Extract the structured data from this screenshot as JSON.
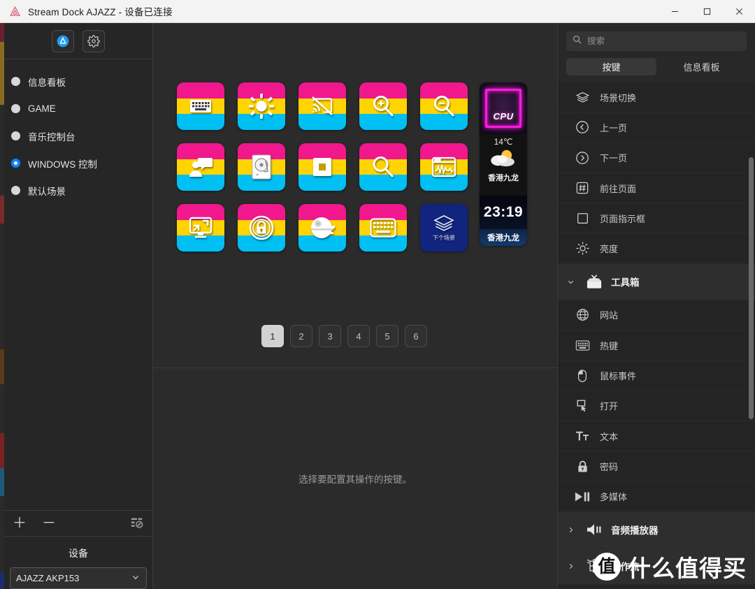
{
  "window": {
    "title": "Stream Dock AJAZZ - 设备已连接",
    "logo_icon": "ajazz-logo-icon",
    "controls": {
      "minimize": "—",
      "maximize": "☐",
      "close": "✕"
    }
  },
  "sidebar": {
    "toolbar": [
      {
        "name": "profile-button",
        "icon": "ajazz-circle-icon"
      },
      {
        "name": "settings-button",
        "icon": "gear-icon"
      }
    ],
    "scenes": [
      {
        "label": "信息看板",
        "selected": false
      },
      {
        "label": "GAME",
        "selected": false
      },
      {
        "label": "音乐控制台",
        "selected": false
      },
      {
        "label": "WINDOWS 控制",
        "selected": true
      },
      {
        "label": "默认场景",
        "selected": false
      }
    ],
    "actions": {
      "add": "＋",
      "remove": "－",
      "edit_icon": "list-edit-icon"
    },
    "device": {
      "title": "设备",
      "selected": "AJAZZ AKP153",
      "chevron": "chevron-down-icon"
    }
  },
  "keys": {
    "grid": [
      {
        "icon": "keyboard-icon",
        "glyph": "keyboard"
      },
      {
        "icon": "brightness-sun-icon",
        "glyph": "sun"
      },
      {
        "icon": "cast-off-icon",
        "glyph": "cast"
      },
      {
        "icon": "zoom-in-icon",
        "glyph": "zoomin"
      },
      {
        "icon": "zoom-out-icon",
        "glyph": "zoomout"
      },
      {
        "icon": "user-chat-icon",
        "glyph": "userchat"
      },
      {
        "icon": "hard-disk-icon",
        "glyph": "disk"
      },
      {
        "icon": "stop-square-icon",
        "glyph": "stop"
      },
      {
        "icon": "search-icon",
        "glyph": "search"
      },
      {
        "icon": "monitor-wave-icon",
        "glyph": "wave"
      },
      {
        "icon": "display-resize-icon",
        "glyph": "display"
      },
      {
        "icon": "lock-circle-icon",
        "glyph": "lock"
      },
      {
        "icon": "death-star-icon",
        "glyph": "deathstar"
      },
      {
        "icon": "onscreen-keyboard-icon",
        "glyph": "oskbd"
      },
      {
        "icon": "layers-icon",
        "glyph": "layers",
        "scene": true,
        "caption": "下个场景"
      }
    ],
    "colors": {
      "band_pink": "#F0188C",
      "band_yellow": "#FFD400",
      "band_cyan": "#00BFF3",
      "scene_bg": "#12257E"
    }
  },
  "info_strip": {
    "cpu_label": "CPU",
    "temperature": "14℃",
    "weather_icon": "sun-cloud-icon",
    "city": "香港九龙",
    "time": "23:19",
    "footer_city": "香港九龙"
  },
  "pagination": {
    "pages": [
      "1",
      "2",
      "3",
      "4",
      "5",
      "6"
    ],
    "active": "1"
  },
  "config": {
    "hint": "选择要配置其操作的按键。"
  },
  "right_panel": {
    "search": {
      "placeholder": "搜索",
      "value": "",
      "icon": "search-icon"
    },
    "tabs": [
      {
        "label": "按键",
        "active": true
      },
      {
        "label": "信息看板",
        "active": false
      }
    ],
    "items": [
      {
        "label": "场景切换",
        "icon": "layers-icon",
        "type": "item"
      },
      {
        "label": "上一页",
        "icon": "chevron-left-circle-icon",
        "type": "item"
      },
      {
        "label": "下一页",
        "icon": "chevron-right-circle-icon",
        "type": "item"
      },
      {
        "label": "前往页面",
        "icon": "hash-box-icon",
        "type": "item"
      },
      {
        "label": "页面指示框",
        "icon": "square-outline-icon",
        "type": "item"
      },
      {
        "label": "亮度",
        "icon": "brightness-icon",
        "type": "item"
      },
      {
        "label": "工具箱",
        "icon": "toolbox-icon",
        "type": "section",
        "expanded": true
      },
      {
        "label": "网站",
        "icon": "globe-icon",
        "type": "item"
      },
      {
        "label": "热键",
        "icon": "keyboard-icon",
        "type": "item"
      },
      {
        "label": "鼠标事件",
        "icon": "mouse-icon",
        "type": "item"
      },
      {
        "label": "打开",
        "icon": "open-cursor-icon",
        "type": "item"
      },
      {
        "label": "文本",
        "icon": "text-tt-icon",
        "type": "item"
      },
      {
        "label": "密码",
        "icon": "lock-icon",
        "type": "item"
      },
      {
        "label": "多媒体",
        "icon": "play-pause-icon",
        "type": "item"
      },
      {
        "label": "音频播放器",
        "icon": "speaker-icon",
        "type": "section",
        "expanded": false
      },
      {
        "label": "操作流",
        "icon": "flow-nodes-icon",
        "type": "section",
        "expanded": false
      }
    ]
  },
  "watermark": {
    "badge": "值",
    "text": "什么值得买"
  }
}
